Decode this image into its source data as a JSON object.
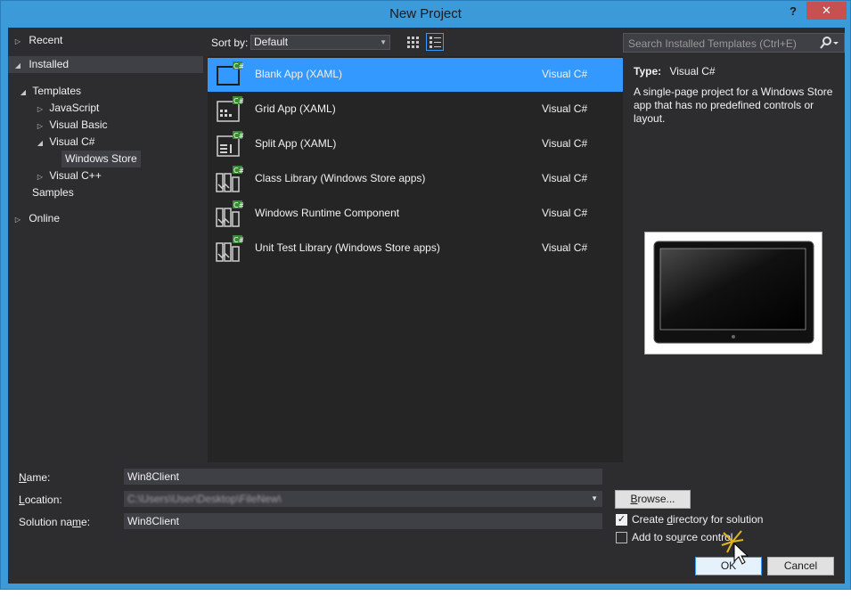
{
  "window": {
    "title": "New Project",
    "help_label": "?",
    "close_label": "✕"
  },
  "tree": {
    "recent": "Recent",
    "installed": "Installed",
    "templates": "Templates",
    "javascript": "JavaScript",
    "visual_basic": "Visual Basic",
    "visual_csharp": "Visual C#",
    "windows_store": "Windows Store",
    "visual_cpp": "Visual C++",
    "samples": "Samples",
    "online": "Online"
  },
  "sortbar": {
    "label": "Sort by:",
    "value": "Default"
  },
  "templates": [
    {
      "name": "Blank App (XAML)",
      "lang": "Visual C#"
    },
    {
      "name": "Grid App (XAML)",
      "lang": "Visual C#"
    },
    {
      "name": "Split App (XAML)",
      "lang": "Visual C#"
    },
    {
      "name": "Class Library (Windows Store apps)",
      "lang": "Visual C#"
    },
    {
      "name": "Windows Runtime Component",
      "lang": "Visual C#"
    },
    {
      "name": "Unit Test Library (Windows Store apps)",
      "lang": "Visual C#"
    }
  ],
  "search": {
    "placeholder": "Search Installed Templates (Ctrl+E)"
  },
  "description": {
    "type_label": "Type:",
    "type_value": "Visual C#",
    "text": "A single-page project for a Windows Store app that has no predefined controls or layout."
  },
  "form": {
    "name_label_pre": "",
    "name_label_u": "N",
    "name_label_post": "ame:",
    "name_value": "Win8Client",
    "location_label_pre": "",
    "location_label_u": "L",
    "location_label_post": "ocation:",
    "location_value": "C:\\Users\\User\\Desktop\\FileNew\\",
    "solution_label_pre": "Solution na",
    "solution_label_u": "m",
    "solution_label_post": "e:",
    "solution_value": "Win8Client",
    "browse_pre": "",
    "browse_u": "B",
    "browse_post": "rowse...",
    "create_dir_pre": "Create ",
    "create_dir_u": "d",
    "create_dir_post": "irectory for solution",
    "create_dir_checked": true,
    "source_ctrl_pre": "Add to so",
    "source_ctrl_u": "u",
    "source_ctrl_post": "rce control",
    "source_ctrl_checked": false,
    "ok_label": "OK",
    "cancel_label": "Cancel"
  },
  "colors": {
    "accent": "#3399ff",
    "frame": "#3c9ad8",
    "background": "#2d2d30",
    "close": "#c75050"
  }
}
